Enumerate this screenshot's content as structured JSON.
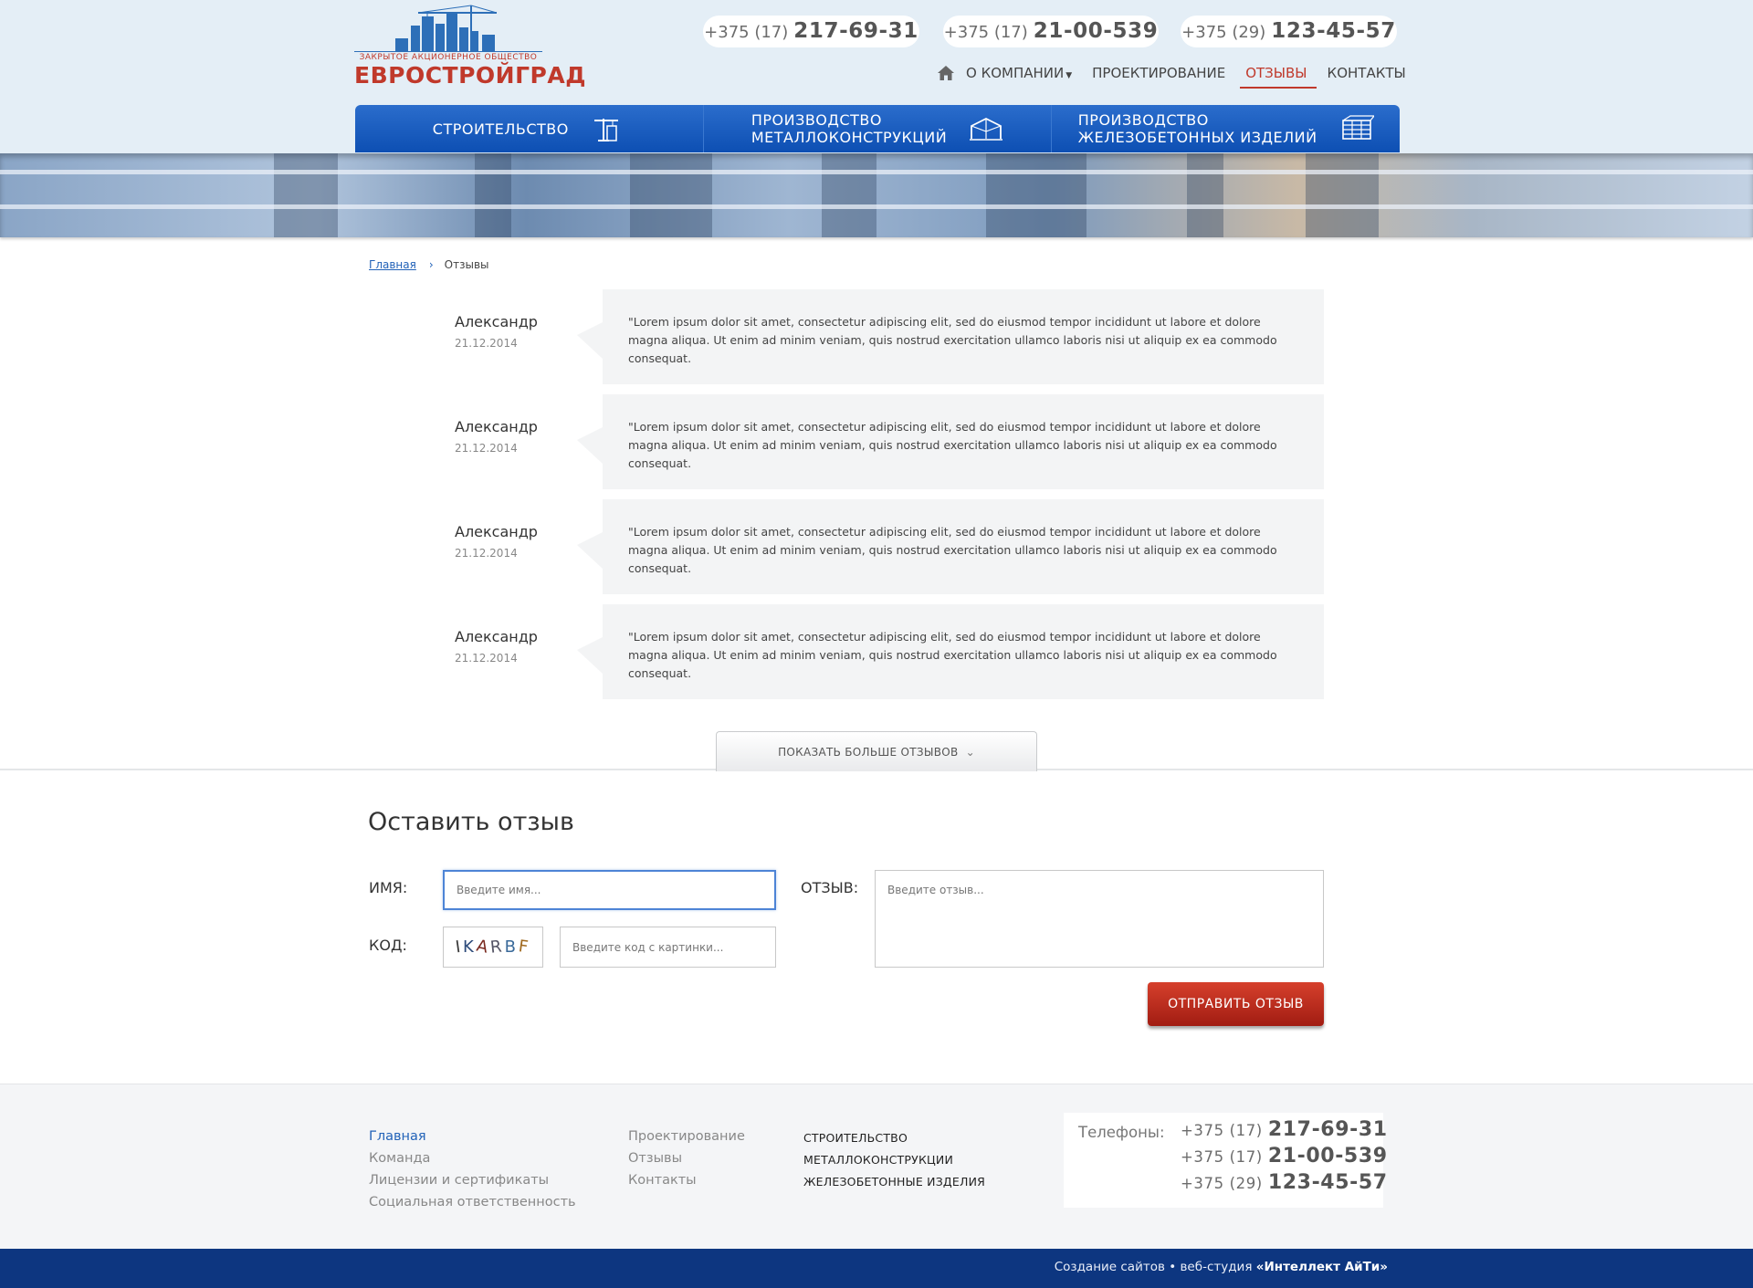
{
  "header": {
    "logo": {
      "subtitle": "ЗАКРЫТОЕ АКЦИОНЕРНОЕ ОБЩЕСТВО",
      "name": "ЕВРОСТРОЙГРАД"
    },
    "phones": [
      {
        "code": "+375 (17)",
        "number": "217-69-31"
      },
      {
        "code": "+375 (17)",
        "number": "21-00-539"
      },
      {
        "code": "+375 (29)",
        "number": "123-45-57"
      }
    ],
    "topnav": {
      "about": "О КОМПАНИИ",
      "design": "ПРОЕКТИРОВАНИЕ",
      "reviews": "ОТЗЫВЫ",
      "contacts": "КОНТАКТЫ",
      "active": "ОТЗЫВЫ"
    },
    "mainnav": {
      "construction": "СТРОИТЕЛЬСТВО",
      "metal_line1": "ПРОИЗВОДСТВО",
      "metal_line2": "МЕТАЛЛОКОНСТРУКЦИЙ",
      "concrete_line1": "ПРОИЗВОДСТВО",
      "concrete_line2": "ЖЕЛЕЗОБЕТОННЫХ ИЗДЕЛИЙ"
    },
    "accent_color": "#0d4fb3",
    "brand_red": "#c0392b"
  },
  "breadcrumb": {
    "home": "Главная",
    "current": "Отзывы"
  },
  "reviews": [
    {
      "author": "Александр",
      "date": "21.12.2014",
      "text": "\"Lorem ipsum dolor sit amet, consectetur adipiscing elit, sed do eiusmod tempor incididunt ut labore et dolore magna aliqua. Ut enim ad minim veniam, quis nostrud exercitation ullamco laboris nisi ut aliquip ex ea commodo consequat."
    },
    {
      "author": "Александр",
      "date": "21.12.2014",
      "text": "\"Lorem ipsum dolor sit amet, consectetur adipiscing elit, sed do eiusmod tempor incididunt ut labore et dolore magna aliqua. Ut enim ad minim veniam, quis nostrud exercitation ullamco laboris nisi ut aliquip ex ea commodo consequat."
    },
    {
      "author": "Александр",
      "date": "21.12.2014",
      "text": "\"Lorem ipsum dolor sit amet, consectetur adipiscing elit, sed do eiusmod tempor incididunt ut labore et dolore magna aliqua. Ut enim ad minim veniam, quis nostrud exercitation ullamco laboris nisi ut aliquip ex ea commodo consequat."
    },
    {
      "author": "Александр",
      "date": "21.12.2014",
      "text": "\"Lorem ipsum dolor sit amet, consectetur adipiscing elit, sed do eiusmod tempor incididunt ut labore et dolore magna aliqua. Ut enim ad minim veniam, quis nostrud exercitation ullamco laboris nisi ut aliquip ex ea commodo consequat."
    }
  ],
  "show_more": "ПОКАЗАТЬ БОЛЬШЕ ОТЗЫВОВ",
  "form": {
    "title": "Оставить отзыв",
    "name_label": "ИМЯ:",
    "name_placeholder": "Введите имя...",
    "code_label": "КОД:",
    "captcha_text": "IKARBF",
    "code_placeholder": "Введите код с картинки...",
    "review_label": "ОТЗЫВ:",
    "review_placeholder": "Введите отзыв...",
    "submit": "ОТПРАВИТЬ ОТЗЫВ"
  },
  "footer": {
    "col1": [
      "Главная",
      "Команда",
      "Лицензии и сертификаты",
      "Социальная ответственность"
    ],
    "col2": [
      "Проектирование",
      "Отзывы",
      "Контакты"
    ],
    "col3": [
      "СТРОИТЕЛЬСТВО",
      "МЕТАЛЛОКОНСТРУКЦИИ",
      "ЖЕЛЕЗОБЕТОННЫЕ ИЗДЕЛИЯ"
    ],
    "phones_label": "Телефоны:",
    "phones": [
      {
        "code": "+375 (17)",
        "number": "217-69-31"
      },
      {
        "code": "+375 (17)",
        "number": "21-00-539"
      },
      {
        "code": "+375 (29)",
        "number": "123-45-57"
      }
    ],
    "credit_prefix": "Создание сайтов • веб-студия",
    "credit_studio": "«Интеллект АйТи»"
  }
}
